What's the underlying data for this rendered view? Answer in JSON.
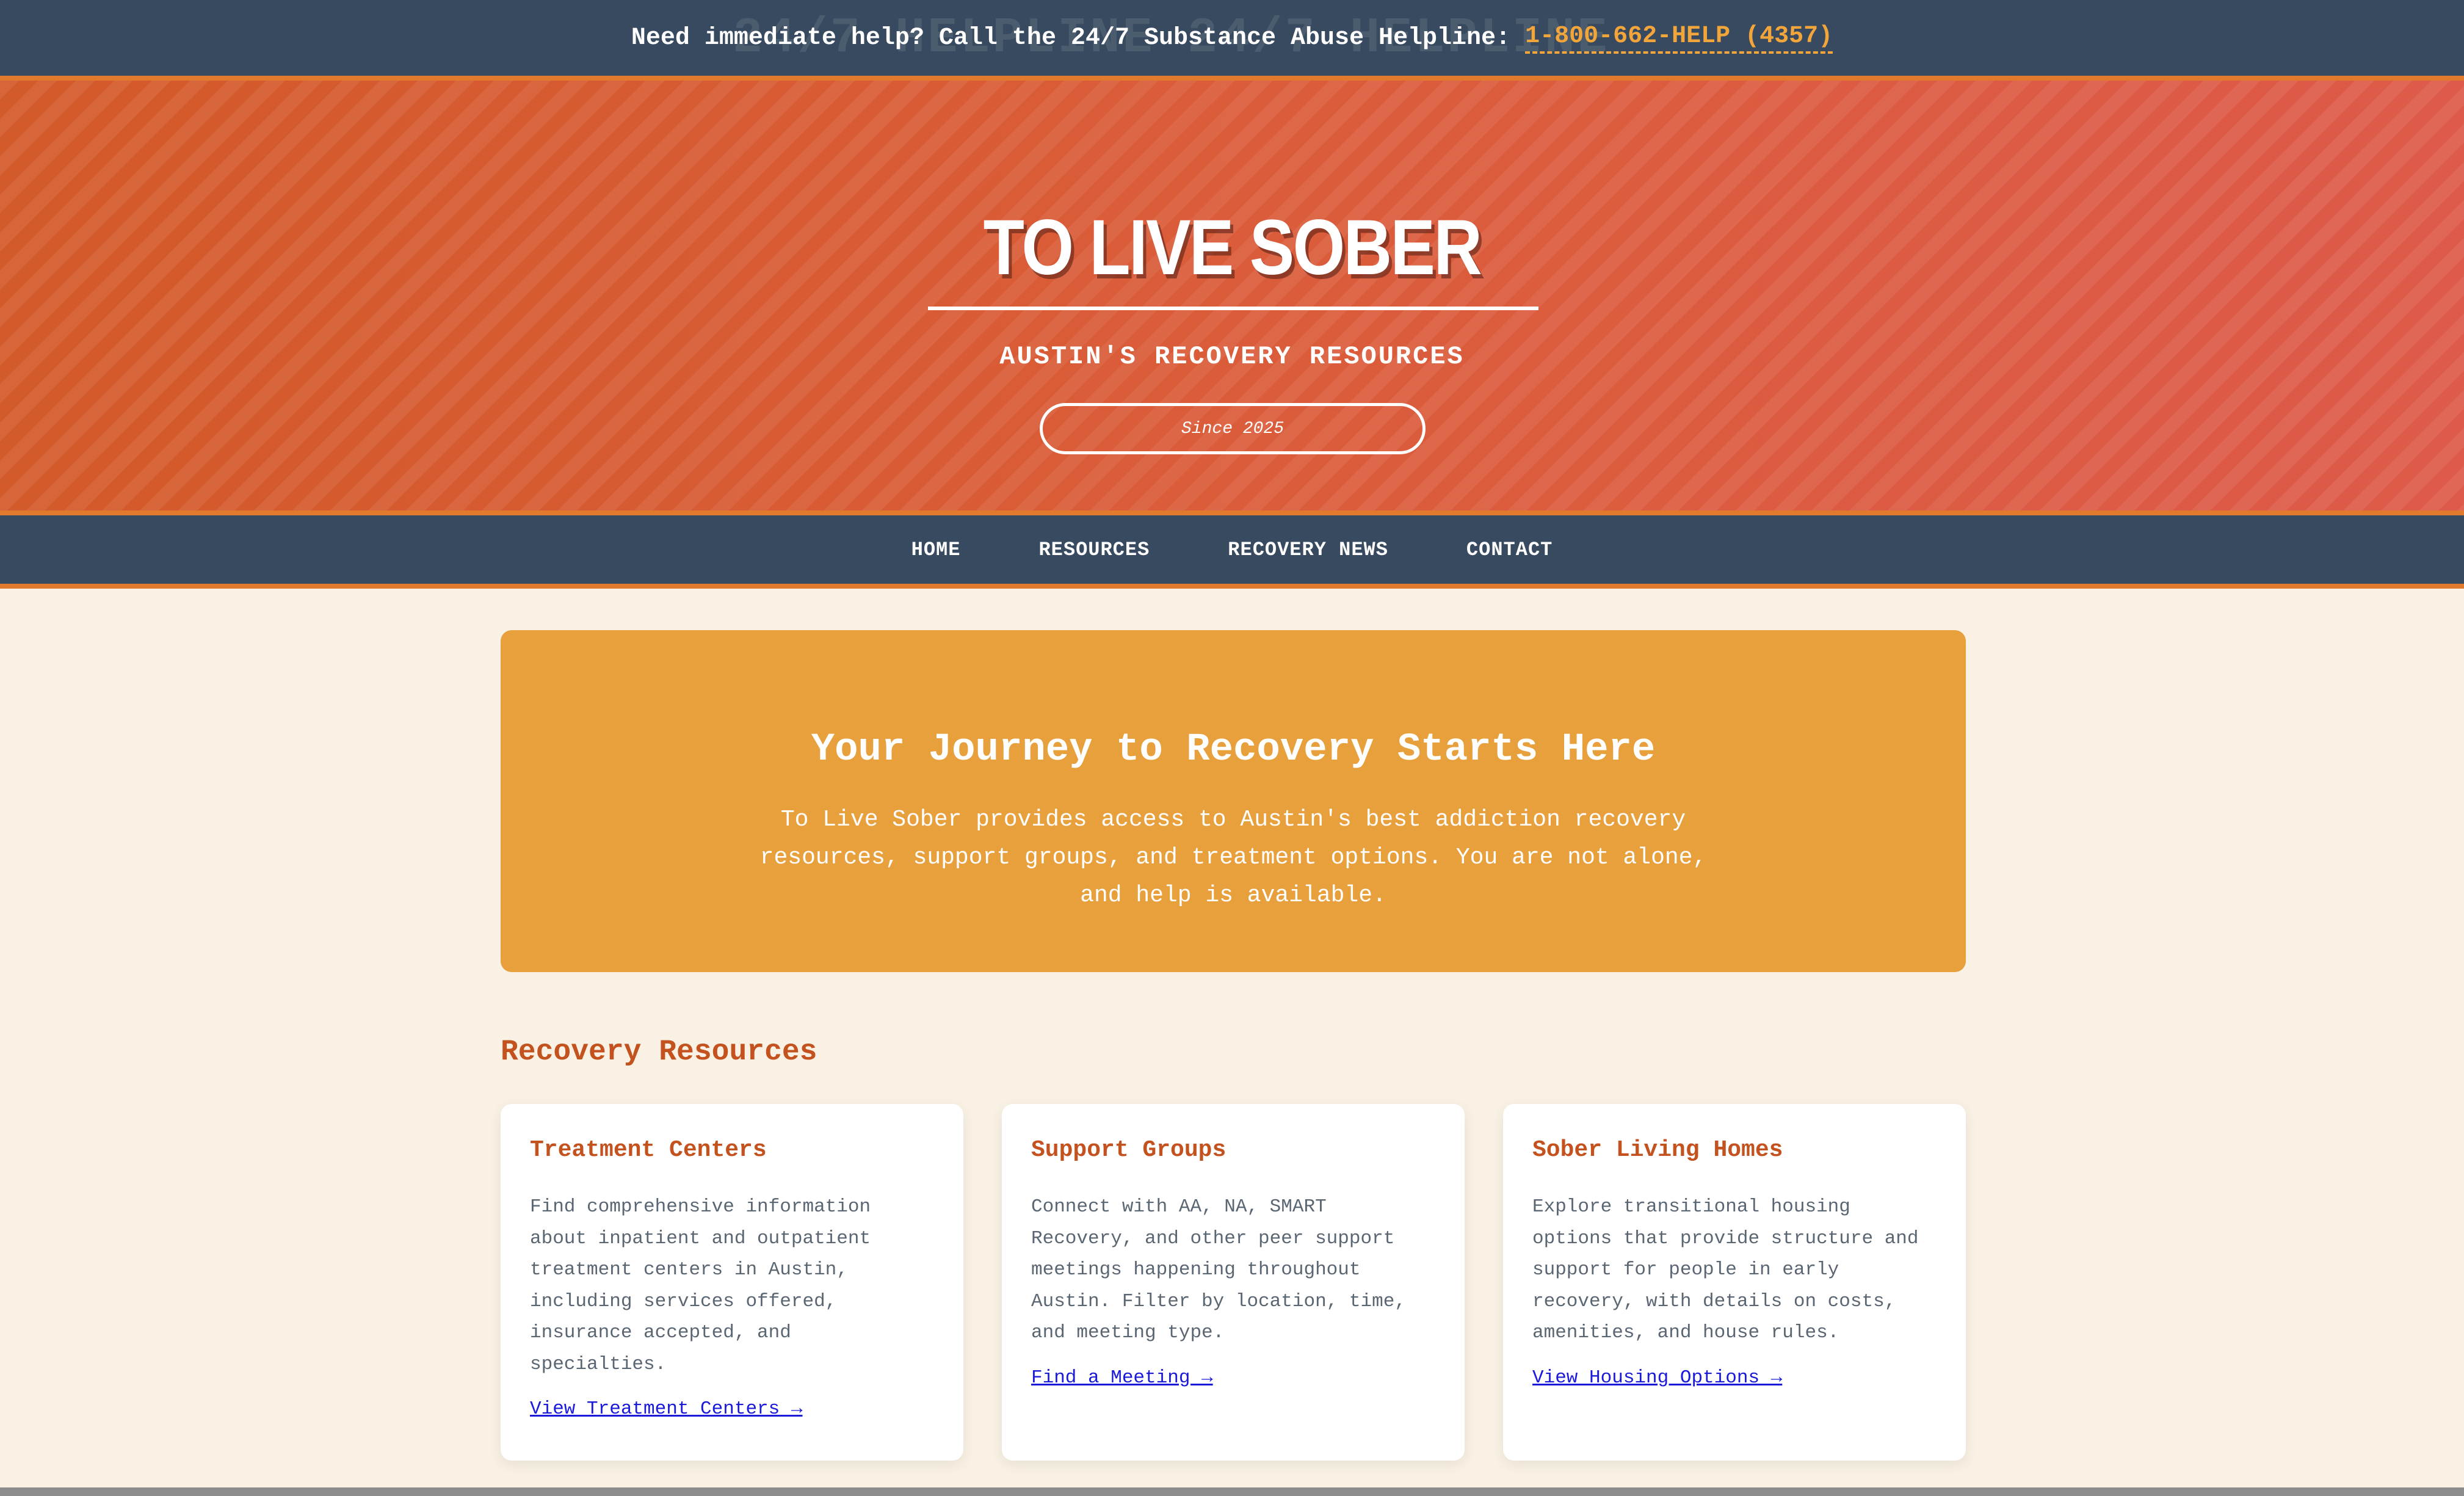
{
  "helpbar": {
    "ghost_text": "24/7 HELPLINE 24/7 HELPLINE",
    "text": "Need immediate help? Call the 24/7 Substance Abuse Helpline:",
    "phone": "1-800-662-HELP (4357)"
  },
  "header": {
    "title": "TO LIVE SOBER",
    "subtitle": "AUSTIN'S RECOVERY RESOURCES",
    "since": "Since 2025"
  },
  "nav": {
    "items": [
      {
        "label": "HOME"
      },
      {
        "label": "RESOURCES"
      },
      {
        "label": "RECOVERY NEWS"
      },
      {
        "label": "CONTACT"
      }
    ]
  },
  "hero": {
    "title": "Your Journey to Recovery Starts Here",
    "body": "To Live Sober provides access to Austin's best addiction recovery resources, support groups, and treatment options. You are not alone, and help is available."
  },
  "resources": {
    "title": "Recovery Resources",
    "cards": [
      {
        "title": "Treatment Centers",
        "body": "Find comprehensive information about inpatient and outpatient treatment centers in Austin, including services offered, insurance accepted, and specialties.",
        "link": "View Treatment Centers →"
      },
      {
        "title": "Support Groups",
        "body": "Connect with AA, NA, SMART Recovery, and other peer support meetings happening throughout Austin. Filter by location, time, and meeting type.",
        "link": "Find a Meeting →"
      },
      {
        "title": "Sober Living Homes",
        "body": "Explore transitional housing options that provide structure and support for people in early recovery, with details on costs, amenities, and house rules.",
        "link": "View Housing Options →"
      }
    ]
  },
  "colors": {
    "navy": "#374a5f",
    "orange_accent": "#e27a2e",
    "hero_orange": "#e8a03c",
    "heading_rust": "#c4521f",
    "page_bg": "#f9f2e4",
    "link_blue": "#1a1ad8",
    "phone_gold": "#f2a53a"
  }
}
